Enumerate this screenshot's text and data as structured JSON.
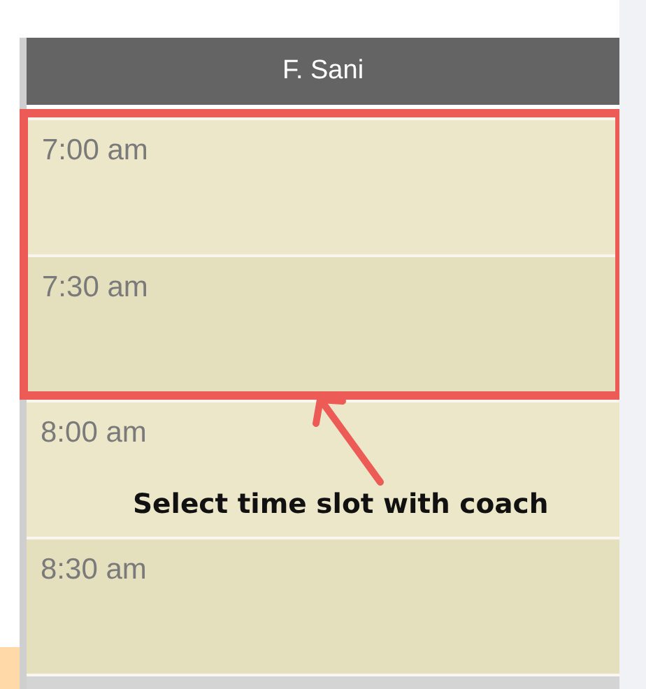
{
  "column": {
    "header": "F. Sani"
  },
  "slots": [
    {
      "time": "7:00 am",
      "highlighted": true
    },
    {
      "time": "7:30 am",
      "highlighted": true
    },
    {
      "time": "8:00 am",
      "highlighted": false
    },
    {
      "time": "8:30 am",
      "highlighted": false
    }
  ],
  "annotation": {
    "text": "Select time slot with coach"
  }
}
